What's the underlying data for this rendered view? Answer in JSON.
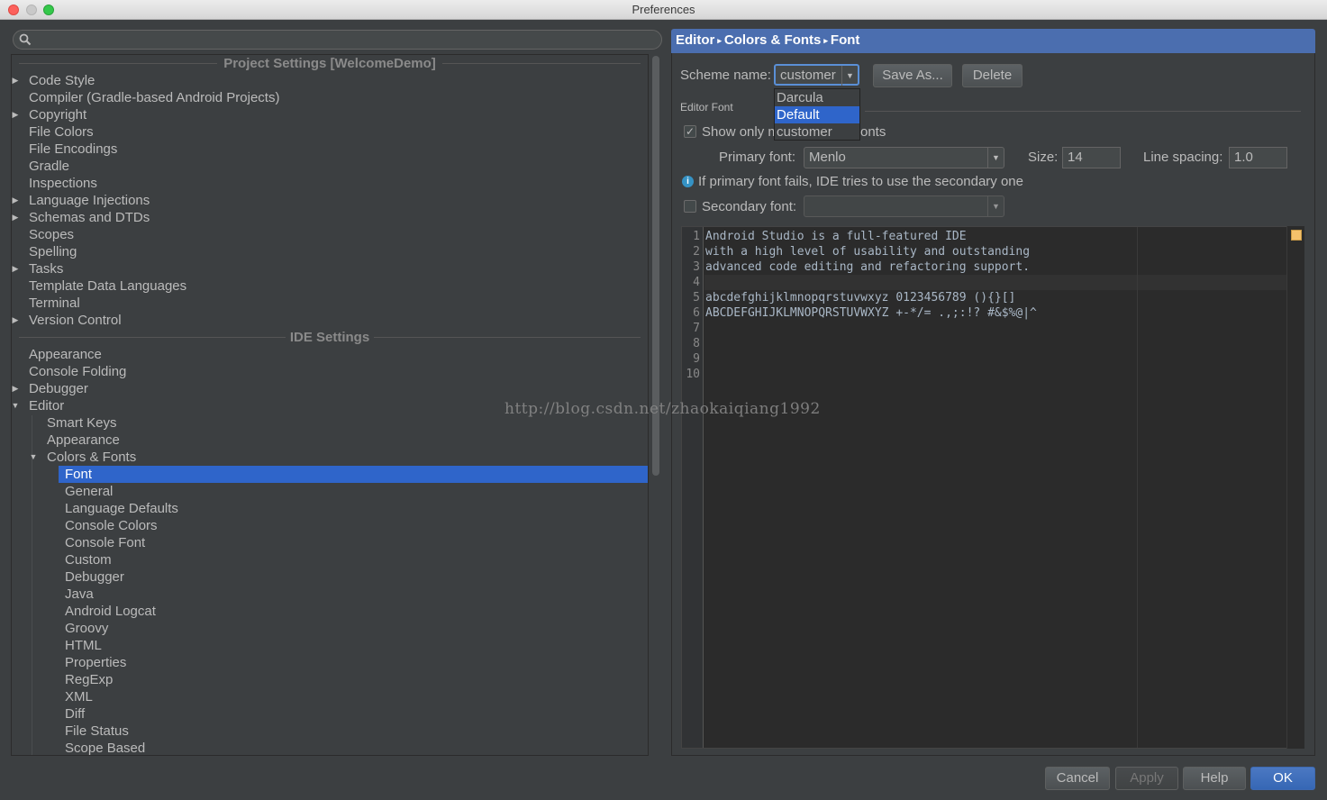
{
  "window": {
    "title": "Preferences"
  },
  "search": {
    "placeholder": ""
  },
  "tree": {
    "project_header": "Project Settings [WelcomeDemo]",
    "project_items": [
      {
        "label": "Code Style",
        "arrow": "▶"
      },
      {
        "label": "Compiler (Gradle-based Android Projects)",
        "arrow": ""
      },
      {
        "label": "Copyright",
        "arrow": "▶"
      },
      {
        "label": "File Colors",
        "arrow": ""
      },
      {
        "label": "File Encodings",
        "arrow": ""
      },
      {
        "label": "Gradle",
        "arrow": ""
      },
      {
        "label": "Inspections",
        "arrow": ""
      },
      {
        "label": "Language Injections",
        "arrow": "▶"
      },
      {
        "label": "Schemas and DTDs",
        "arrow": "▶"
      },
      {
        "label": "Scopes",
        "arrow": ""
      },
      {
        "label": "Spelling",
        "arrow": ""
      },
      {
        "label": "Tasks",
        "arrow": "▶"
      },
      {
        "label": "Template Data Languages",
        "arrow": ""
      },
      {
        "label": "Terminal",
        "arrow": ""
      },
      {
        "label": "Version Control",
        "arrow": "▶"
      }
    ],
    "ide_header": "IDE Settings",
    "ide_items": [
      {
        "label": "Appearance",
        "arrow": ""
      },
      {
        "label": "Console Folding",
        "arrow": ""
      },
      {
        "label": "Debugger",
        "arrow": "▶"
      },
      {
        "label": "Editor",
        "arrow": "▼"
      }
    ],
    "editor_children": [
      {
        "label": "Smart Keys",
        "arrow": ""
      },
      {
        "label": "Appearance",
        "arrow": ""
      },
      {
        "label": "Colors & Fonts",
        "arrow": "▼"
      }
    ],
    "colors_fonts_children": [
      "Font",
      "General",
      "Language Defaults",
      "Console Colors",
      "Console Font",
      "Custom",
      "Debugger",
      "Java",
      "Android Logcat",
      "Groovy",
      "HTML",
      "Properties",
      "RegExp",
      "XML",
      "Diff",
      "File Status",
      "Scope Based"
    ],
    "selected": "Font"
  },
  "breadcrumb": [
    "Editor",
    "Colors & Fonts",
    "Font"
  ],
  "breadcrumb_sep": "▸",
  "scheme": {
    "label": "Scheme name:",
    "value": "customer",
    "options": [
      "Darcula",
      "Default",
      "customer"
    ],
    "highlighted": "Default",
    "save_as": "Save As...",
    "delete": "Delete"
  },
  "editor_font": {
    "group_label": "Editor Font",
    "show_only_prefix": "Show only m",
    "show_only_suffix": "onts",
    "show_only_checked": true,
    "primary_label": "Primary font:",
    "primary_value": "Menlo",
    "size_label": "Size:",
    "size_value": "14",
    "spacing_label": "Line spacing:",
    "spacing_value": "1.0",
    "info_text": "If primary font fails, IDE tries to use the secondary one",
    "secondary_label": "Secondary font:",
    "secondary_value": "",
    "secondary_checked": false
  },
  "preview": {
    "lines": [
      {
        "n": "1",
        "text": "Android Studio is a full-featured IDE"
      },
      {
        "n": "2",
        "text": "with a high level of usability and outstanding"
      },
      {
        "n": "3",
        "text": "advanced code editing and refactoring support."
      },
      {
        "n": "4",
        "text": ""
      },
      {
        "n": "5",
        "text": "abcdefghijklmnopqrstuvwxyz 0123456789 (){}[]"
      },
      {
        "n": "6",
        "text": "ABCDEFGHIJKLMNOPQRSTUVWXYZ +-*/= .,;:!? #&$%@|^"
      },
      {
        "n": "7",
        "text": ""
      },
      {
        "n": "8",
        "text": ""
      },
      {
        "n": "9",
        "text": ""
      },
      {
        "n": "10",
        "text": ""
      }
    ]
  },
  "watermark": "http://blog.csdn.net/zhaokaiqiang1992",
  "footer": {
    "cancel": "Cancel",
    "apply": "Apply",
    "help": "Help",
    "ok": "OK"
  }
}
